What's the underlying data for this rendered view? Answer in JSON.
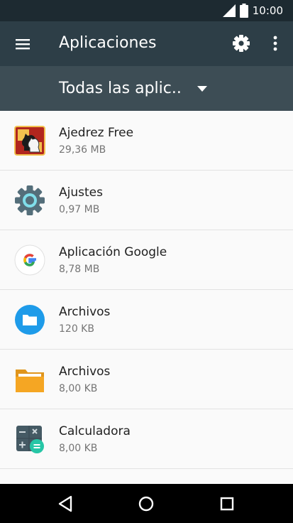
{
  "status_bar": {
    "time": "10:00",
    "icons": [
      "signal-icon",
      "battery-icon"
    ]
  },
  "app_bar": {
    "title": "Aplicaciones",
    "icons": [
      "menu-icon",
      "gear-icon",
      "more-vert-icon"
    ]
  },
  "filter": {
    "selected": "Todas las aplic..",
    "icon": "dropdown-arrow-icon"
  },
  "apps": [
    {
      "name": "Ajedrez Free",
      "size": "29,36 MB",
      "icon": "chess-knight-icon"
    },
    {
      "name": "Ajustes",
      "size": "0,97 MB",
      "icon": "settings-gear-icon"
    },
    {
      "name": "Aplicación Google",
      "size": "8,78 MB",
      "icon": "google-g-icon"
    },
    {
      "name": "Archivos",
      "size": "120 KB",
      "icon": "files-blue-folder-icon"
    },
    {
      "name": "Archivos",
      "size": "8,00 KB",
      "icon": "orange-folder-icon"
    },
    {
      "name": "Calculadora",
      "size": "8,00 KB",
      "icon": "calculator-icon"
    }
  ],
  "nav_bar": {
    "icons": [
      "back-icon",
      "home-icon",
      "recents-icon"
    ]
  },
  "colors": {
    "status_bar": "#1d2a31",
    "app_bar": "#2d3e47",
    "filter_bar": "#3d4d55",
    "background": "#fafafa"
  }
}
